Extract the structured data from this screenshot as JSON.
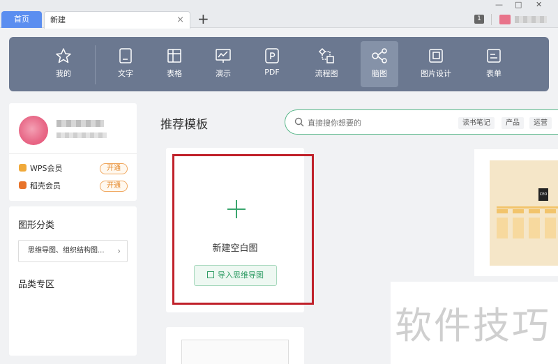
{
  "tabs": {
    "home_label": "首页",
    "new_label": "新建",
    "close_symbol": "×",
    "add_symbol": "+"
  },
  "window": {
    "badge_count": "1",
    "minimize": "—",
    "maximize": "□",
    "close": "✕"
  },
  "toolbar": {
    "items": [
      {
        "label": "我的",
        "icon": "star-icon"
      },
      {
        "label": "文字",
        "icon": "document-icon"
      },
      {
        "label": "表格",
        "icon": "table-icon"
      },
      {
        "label": "演示",
        "icon": "presentation-icon"
      },
      {
        "label": "PDF",
        "icon": "pdf-icon"
      },
      {
        "label": "流程图",
        "icon": "flowchart-icon"
      },
      {
        "label": "脑图",
        "icon": "mindmap-icon",
        "active": true
      },
      {
        "label": "图片设计",
        "icon": "image-design-icon"
      },
      {
        "label": "表单",
        "icon": "form-icon"
      }
    ],
    "active_color": "#8592a8",
    "background_color": "#6b7890"
  },
  "profile": {
    "wps_member_label": "WPS会员",
    "daoke_member_label": "稻壳会员",
    "open_label_1": "开通",
    "open_label_2": "开通"
  },
  "categories": {
    "title": "图形分类",
    "select_value": "思维导图、组织结构图...",
    "chevron": "›",
    "section2_title": "品类专区"
  },
  "main": {
    "title": "推荐模板",
    "search_placeholder": "直接搜你想要的",
    "search_tags": [
      "读书笔记",
      "产品",
      "运营"
    ],
    "blank_label": "新建空白图",
    "import_label": "导入思维导图",
    "accent_color": "#3aa66e",
    "highlight_color": "#c0212a"
  },
  "preview": {
    "root_label": "CEO"
  },
  "watermark": "软件技巧"
}
